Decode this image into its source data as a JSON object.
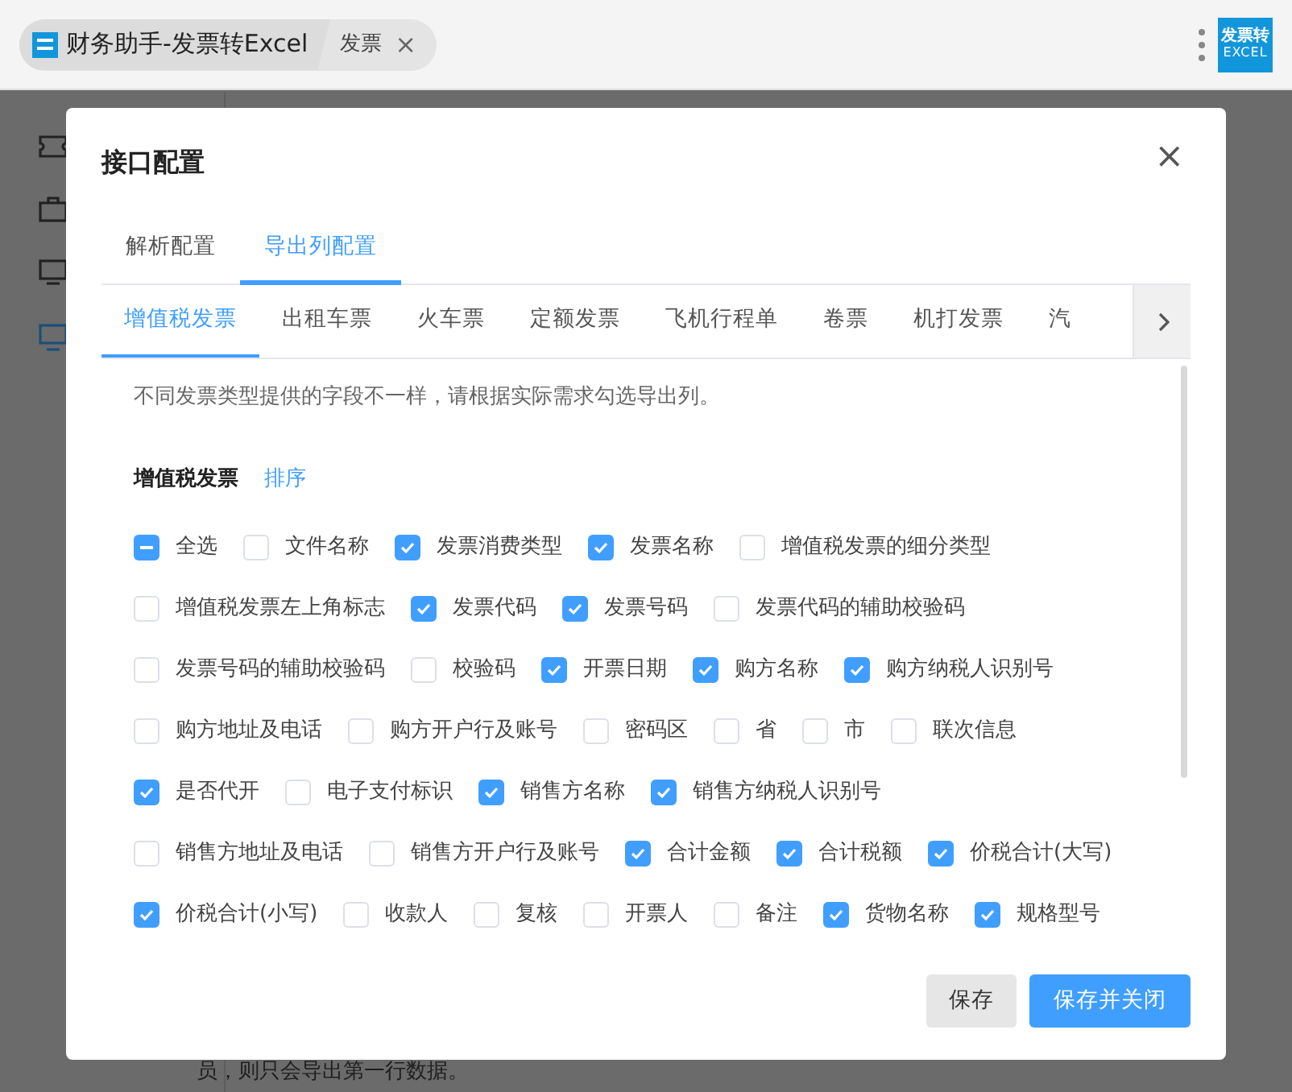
{
  "app_tabs": [
    {
      "label": "财务助手-发票转Excel",
      "kind": "app"
    },
    {
      "label": "发票",
      "kind": "page",
      "close": "×"
    }
  ],
  "logo": {
    "line1": "发票转",
    "line2": "EXCEL"
  },
  "background_text": "员，则只会导出第一行数据。",
  "dialog": {
    "title": "接口配置",
    "close": "×",
    "tabs": [
      {
        "label": "解析配置",
        "selected": false
      },
      {
        "label": "导出列配置",
        "selected": true
      }
    ],
    "invoice_tabs": [
      {
        "label": "增值税发票",
        "selected": true
      },
      {
        "label": "出租车票",
        "selected": false
      },
      {
        "label": "火车票",
        "selected": false
      },
      {
        "label": "定额发票",
        "selected": false
      },
      {
        "label": "飞机行程单",
        "selected": false
      },
      {
        "label": "卷票",
        "selected": false
      },
      {
        "label": "机打发票",
        "selected": false
      },
      {
        "label": "汽",
        "selected": false
      }
    ],
    "hint": "不同发票类型提供的字段不一样，请根据实际需求勾选导出列。",
    "section_title": "增值税发票",
    "sort_link": "排序",
    "field_rows": [
      [
        {
          "label": "全选",
          "indeterminate": true
        },
        {
          "label": "文件名称",
          "checked": false
        },
        {
          "label": "发票消费类型",
          "checked": true
        },
        {
          "label": "发票名称",
          "checked": true
        },
        {
          "label": "增值税发票的细分类型",
          "checked": false
        }
      ],
      [
        {
          "label": "增值税发票左上角标志",
          "checked": false
        },
        {
          "label": "发票代码",
          "checked": true
        },
        {
          "label": "发票号码",
          "checked": true
        },
        {
          "label": "发票代码的辅助校验码",
          "checked": false
        }
      ],
      [
        {
          "label": "发票号码的辅助校验码",
          "checked": false
        },
        {
          "label": "校验码",
          "checked": false
        },
        {
          "label": "开票日期",
          "checked": true
        },
        {
          "label": "购方名称",
          "checked": true
        },
        {
          "label": "购方纳税人识别号",
          "checked": true
        }
      ],
      [
        {
          "label": "购方地址及电话",
          "checked": false
        },
        {
          "label": "购方开户行及账号",
          "checked": false
        },
        {
          "label": "密码区",
          "checked": false
        },
        {
          "label": "省",
          "checked": false
        },
        {
          "label": "市",
          "checked": false
        },
        {
          "label": "联次信息",
          "checked": false
        }
      ],
      [
        {
          "label": "是否代开",
          "checked": true
        },
        {
          "label": "电子支付标识",
          "checked": false
        },
        {
          "label": "销售方名称",
          "checked": true
        },
        {
          "label": "销售方纳税人识别号",
          "checked": true
        }
      ],
      [
        {
          "label": "销售方地址及电话",
          "checked": false
        },
        {
          "label": "销售方开户行及账号",
          "checked": false
        },
        {
          "label": "合计金额",
          "checked": true
        },
        {
          "label": "合计税额",
          "checked": true
        },
        {
          "label": "价税合计(大写)",
          "checked": true
        }
      ],
      [
        {
          "label": "价税合计(小写)",
          "checked": true
        },
        {
          "label": "收款人",
          "checked": false
        },
        {
          "label": "复核",
          "checked": false
        },
        {
          "label": "开票人",
          "checked": false
        },
        {
          "label": "备注",
          "checked": false
        },
        {
          "label": "货物名称",
          "checked": true
        },
        {
          "label": "规格型号",
          "checked": true
        }
      ]
    ],
    "buttons": [
      {
        "label": "保存",
        "kind": "secondary"
      },
      {
        "label": "保存并关闭",
        "kind": "primary"
      }
    ]
  }
}
